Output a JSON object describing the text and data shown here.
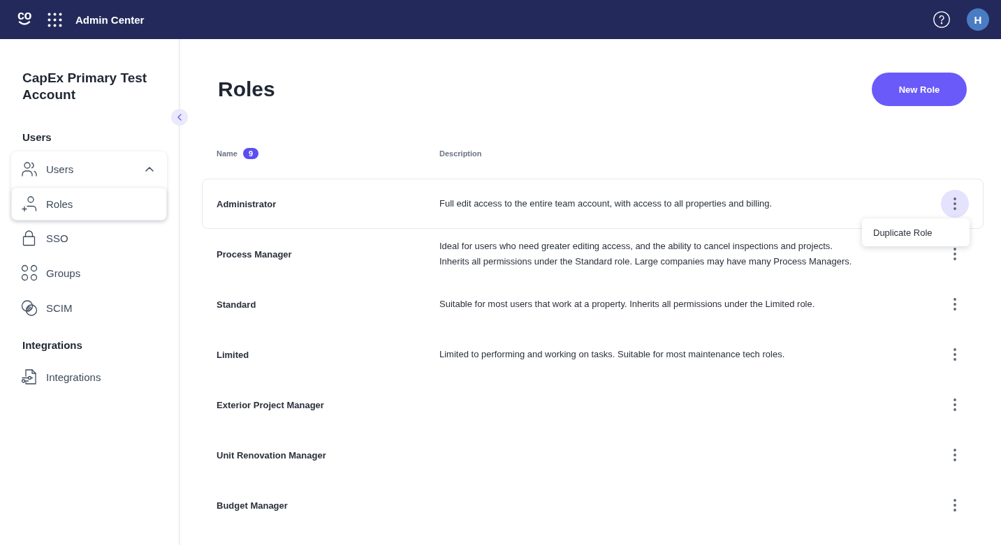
{
  "top_bar": {
    "logo_text": "co",
    "title": "Admin Center",
    "avatar_initial": "H"
  },
  "sidebar": {
    "account_name": "CapEx Primary Test Account",
    "sections": [
      {
        "heading": "Users",
        "items": [
          {
            "kind": "users",
            "label": "Users",
            "selected": false,
            "expanded": true,
            "children": [
              {
                "kind": "roles",
                "label": "Roles",
                "selected": true
              }
            ]
          },
          {
            "kind": "sso",
            "label": "SSO",
            "selected": false
          },
          {
            "kind": "groups",
            "label": "Groups",
            "selected": false
          },
          {
            "kind": "scim",
            "label": "SCIM",
            "selected": false
          }
        ]
      },
      {
        "heading": "Integrations",
        "items": [
          {
            "kind": "integrations",
            "label": "Integrations",
            "selected": false
          }
        ]
      }
    ]
  },
  "page": {
    "title": "Roles",
    "primary_button": "New Role"
  },
  "table": {
    "columns": [
      {
        "label": "Name",
        "count": "9"
      },
      {
        "label": "Description"
      }
    ],
    "rows": [
      {
        "name": "Administrator",
        "description": "Full edit access to the entire team account, with access to all properties and billing.",
        "menu_open": true
      },
      {
        "name": "Process Manager",
        "description": "Ideal for users who need greater editing access, and the ability to cancel inspections and projects. Inherits all permissions under the Standard role. Large companies may have many Process Managers.",
        "menu_open": false
      },
      {
        "name": "Standard",
        "description": "Suitable for most users that work at a property. Inherits all permissions under the Limited role.",
        "menu_open": false
      },
      {
        "name": "Limited",
        "description": "Limited to performing and working on tasks. Suitable for most maintenance tech roles.",
        "menu_open": false
      },
      {
        "name": "Exterior Project Manager",
        "menu_open": false
      },
      {
        "name": "Unit Renovation Manager",
        "menu_open": false
      },
      {
        "name": "Budget Manager",
        "menu_open": false
      }
    ],
    "row_menu": [
      {
        "label": "Duplicate Role"
      }
    ]
  }
}
